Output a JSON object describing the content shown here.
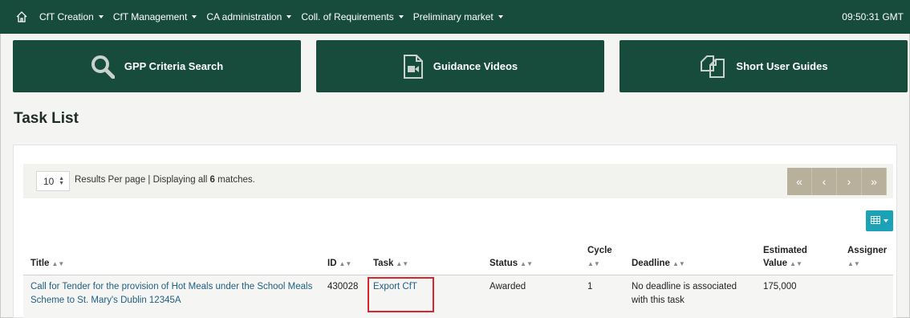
{
  "nav": {
    "items": [
      "CfT Creation",
      "CfT Management",
      "CA administration",
      "Coll. of Requirements",
      "Preliminary market"
    ],
    "clock": "09:50:31 GMT"
  },
  "tiles": [
    {
      "label": "GPP Criteria Search",
      "icon": "search-icon"
    },
    {
      "label": "Guidance Videos",
      "icon": "video-file-icon"
    },
    {
      "label": "Short User Guides",
      "icon": "documents-icon"
    }
  ],
  "page_title": "Task List",
  "toolbar": {
    "per_page": "10",
    "results_prefix": "Results Per page | Displaying all ",
    "results_count": "6",
    "results_suffix": " matches.",
    "pager": [
      "«",
      "‹",
      "›",
      "»"
    ]
  },
  "table": {
    "headers": {
      "title": "Title",
      "id": "ID",
      "task": "Task",
      "status": "Status",
      "cycle": "Cycle",
      "deadline": "Deadline",
      "value_line1": "Estimated",
      "value_line2": "Value",
      "assigner": "Assigner"
    },
    "rows": [
      {
        "title_line1": "Call for Tender for the provision of Hot Meals under the School Meals",
        "title_line2": "Scheme to St. Mary's Dublin 12345A",
        "id": "430028",
        "task": "Export CfT",
        "status": "Awarded",
        "cycle": "1",
        "deadline_line1": "No deadline is associated",
        "deadline_line2": "with this task",
        "value": "175,000",
        "assigner": ""
      }
    ]
  },
  "colors": {
    "brand": "#174b3b",
    "pager": "#b8b09a",
    "accent": "#1ba2b7",
    "highlight": "#d9262e"
  }
}
